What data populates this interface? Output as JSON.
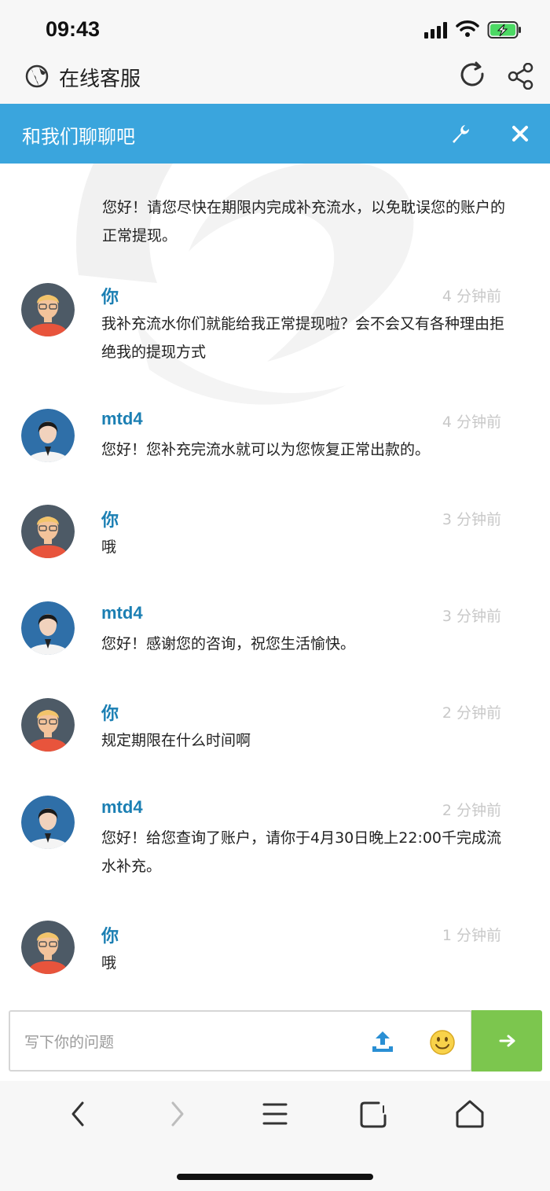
{
  "status_bar": {
    "time": "09:43",
    "icons": [
      "signal-icon",
      "wifi-icon",
      "battery-charging-icon"
    ]
  },
  "browser": {
    "title": "在线客服",
    "icons": [
      "globe-icon",
      "refresh-icon",
      "share-icon"
    ]
  },
  "chat": {
    "banner_title": "和我们聊聊吧",
    "banner_icons": [
      "wrench-icon",
      "close-icon"
    ]
  },
  "first_message": {
    "text": "您好！请您尽快在期限内完成补充流水，以免耽误您的账户的正常提现。"
  },
  "messages": [
    {
      "sender": "你",
      "role": "user",
      "time": "4 分钟前",
      "text": "我补充流水你们就能给我正常提现啦？会不会又有各种理由拒绝我的提现方式"
    },
    {
      "sender": "mtd4",
      "role": "agent",
      "time": "4 分钟前",
      "text": "您好！您补充完流水就可以为您恢复正常出款的。"
    },
    {
      "sender": "你",
      "role": "user",
      "time": "3 分钟前",
      "text": "哦"
    },
    {
      "sender": "mtd4",
      "role": "agent",
      "time": "3 分钟前",
      "text": "您好！感谢您的咨询，祝您生活愉快。"
    },
    {
      "sender": "你",
      "role": "user",
      "time": "2 分钟前",
      "text": "规定期限在什么时间啊"
    },
    {
      "sender": "mtd4",
      "role": "agent",
      "time": "2 分钟前",
      "text": "您好！给您查询了账户，请你于4月30日晚上22:00千完成流水补充。"
    },
    {
      "sender": "你",
      "role": "user",
      "time": "1 分钟前",
      "text": "哦"
    }
  ],
  "input": {
    "placeholder": "写下你的问题",
    "value": "",
    "icons": [
      "upload-icon",
      "emoji-icon",
      "send-arrow-icon"
    ]
  },
  "bottom_nav": {
    "icons": [
      "back-icon",
      "forward-icon",
      "menu-icon",
      "tabs-icon",
      "home-icon"
    ]
  },
  "colors": {
    "banner": "#3aa5dd",
    "name": "#1b7fb3",
    "send": "#7cc64e",
    "time": "#c8c8c8"
  }
}
